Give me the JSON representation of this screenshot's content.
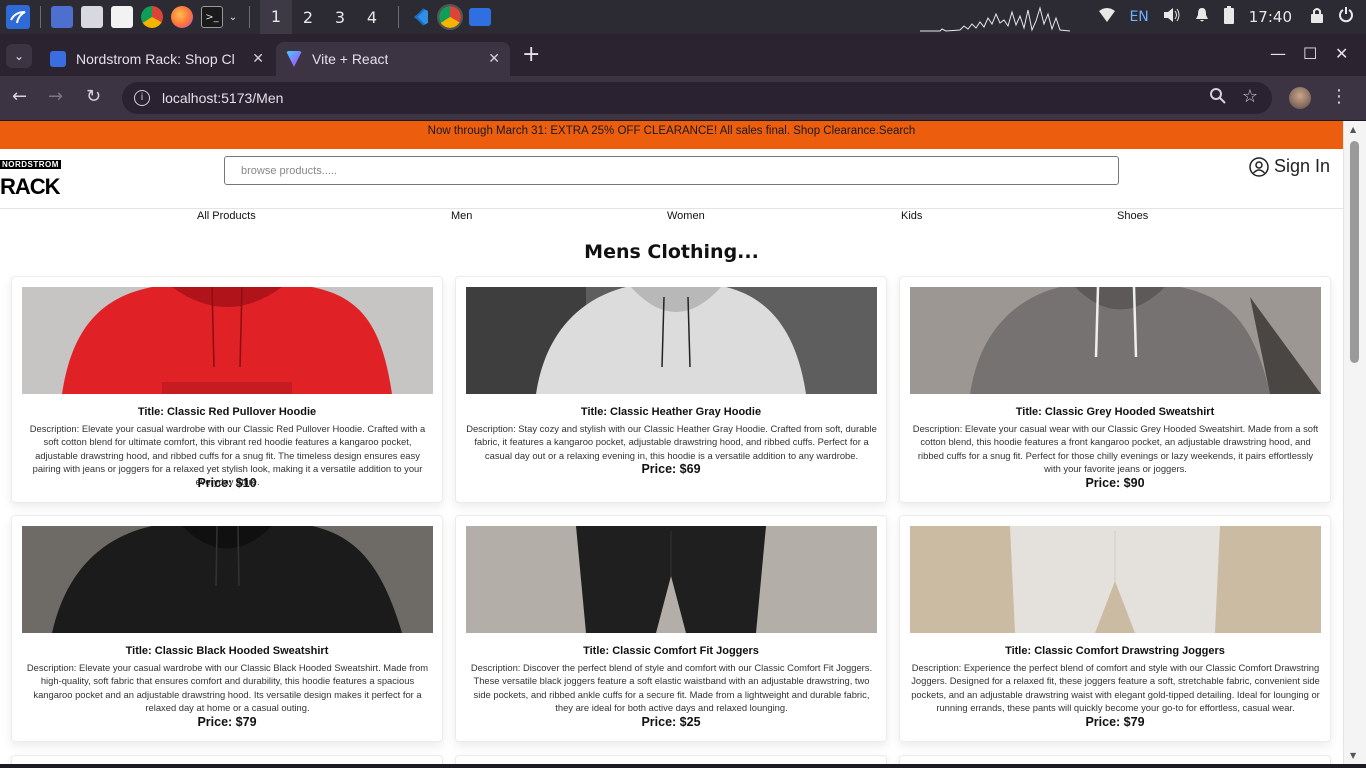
{
  "taskbar": {
    "workspaces": [
      "1",
      "2",
      "3",
      "4"
    ],
    "language": "EN",
    "clock": "17:40"
  },
  "browser": {
    "tabs": [
      {
        "title": "Nordstrom Rack: Shop Cl",
        "favicon_color": "#3a6ee0"
      },
      {
        "title": "Vite + React",
        "favicon_color": "#9d6cf5"
      }
    ],
    "url": "localhost:5173/Men"
  },
  "page": {
    "promo": "Now through March 31: EXTRA 25% OFF CLEARANCE! All sales final. Shop Clearance.Search",
    "logo": {
      "top": "NORDSTROM",
      "main": "RACK"
    },
    "search_placeholder": "browse products.....",
    "signin": "Sign In",
    "categories": [
      "All Products",
      "Men",
      "Women",
      "Kids",
      "Shoes"
    ],
    "heading": "Mens Clothing...",
    "products": [
      {
        "title": "Title: Classic Red Pullover Hoodie",
        "description": "Description: Elevate your casual wardrobe with our Classic Red Pullover Hoodie. Crafted with a soft cotton blend for ultimate comfort, this vibrant red hoodie features a kangaroo pocket, adjustable drawstring hood, and ribbed cuffs for a snug fit. The timeless design ensures easy pairing with jeans or joggers for a relaxed yet stylish look, making it a versatile addition to your everyday attire.",
        "price": "Price: $10",
        "image": "red-hoodie"
      },
      {
        "title": "Title: Classic Heather Gray Hoodie",
        "description": "Description: Stay cozy and stylish with our Classic Heather Gray Hoodie. Crafted from soft, durable fabric, it features a kangaroo pocket, adjustable drawstring hood, and ribbed cuffs. Perfect for a casual day out or a relaxing evening in, this hoodie is a versatile addition to any wardrobe.",
        "price": "Price: $69",
        "image": "heather-gray-hoodie"
      },
      {
        "title": "Title: Classic Grey Hooded Sweatshirt",
        "description": "Description: Elevate your casual wear with our Classic Grey Hooded Sweatshirt. Made from a soft cotton blend, this hoodie features a front kangaroo pocket, an adjustable drawstring hood, and ribbed cuffs for a snug fit. Perfect for those chilly evenings or lazy weekends, it pairs effortlessly with your favorite jeans or joggers.",
        "price": "Price: $90",
        "image": "grey-sweatshirt"
      },
      {
        "title": "Title: Classic Black Hooded Sweatshirt",
        "description": "Description: Elevate your casual wardrobe with our Classic Black Hooded Sweatshirt. Made from high-quality, soft fabric that ensures comfort and durability, this hoodie features a spacious kangaroo pocket and an adjustable drawstring hood. Its versatile design makes it perfect for a relaxed day at home or a casual outing.",
        "price": "Price: $79",
        "image": "black-sweatshirt"
      },
      {
        "title": "Title: Classic Comfort Fit Joggers",
        "description": "Description: Discover the perfect blend of style and comfort with our Classic Comfort Fit Joggers. These versatile black joggers feature a soft elastic waistband with an adjustable drawstring, two side pockets, and ribbed ankle cuffs for a secure fit. Made from a lightweight and durable fabric, they are ideal for both active days and relaxed lounging.",
        "price": "Price: $25",
        "image": "black-joggers"
      },
      {
        "title": "Title: Classic Comfort Drawstring Joggers",
        "description": "Description: Experience the perfect blend of comfort and style with our Classic Comfort Drawstring Joggers. Designed for a relaxed fit, these joggers feature a soft, stretchable fabric, convenient side pockets, and an adjustable drawstring waist with elegant gold-tipped detailing. Ideal for lounging or running errands, these pants will quickly become your go-to for effortless, casual wear.",
        "price": "Price: $79",
        "image": "beige-joggers"
      }
    ]
  },
  "colors": {
    "promo": "#ec5d0e",
    "chrome_dark": "#2b2330",
    "chrome_light": "#3c3343"
  }
}
